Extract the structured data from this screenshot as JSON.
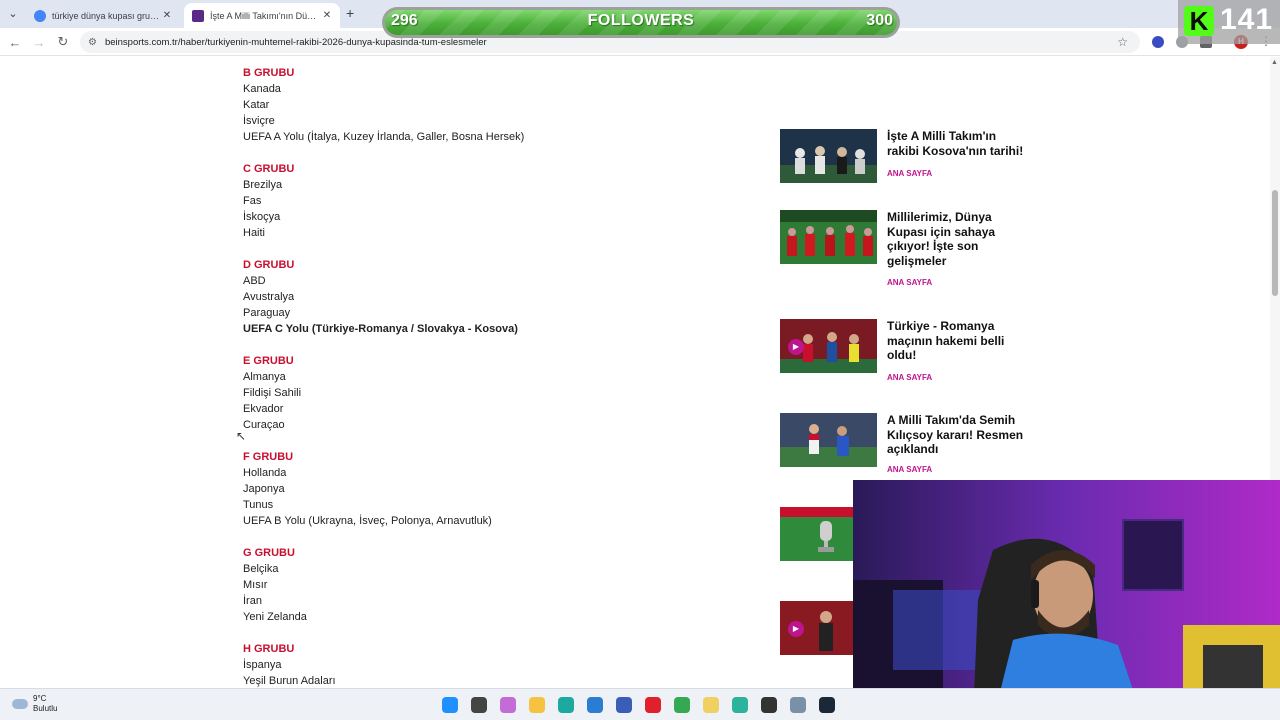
{
  "browser": {
    "tabs": [
      {
        "title": "türkiye dünya kupası gruplar - G",
        "active": false,
        "favicon_color": "#4285f4"
      },
      {
        "title": "İşte A Milli Takımı'nın Dünya Ku",
        "active": true,
        "favicon_color": "#5b2a86"
      }
    ],
    "url": "beinsports.com.tr/haber/turkiyenin-muhtemel-rakibi-2026-dunya-kupasinda-tum-eslesmeler",
    "profile_initial": "H"
  },
  "overlay": {
    "followers_current": "296",
    "followers_label": "FOLLOWERS",
    "followers_goal": "300",
    "kick_logo": "K",
    "kick_viewers": "141"
  },
  "groups": [
    {
      "name": "B GRUBU",
      "teams": [
        {
          "t": "Kanada"
        },
        {
          "t": "Katar"
        },
        {
          "t": "İsviçre"
        },
        {
          "t": "UEFA A Yolu (İtalya, Kuzey İrlanda, Galler, Bosna Hersek)"
        }
      ]
    },
    {
      "name": "C GRUBU",
      "teams": [
        {
          "t": "Brezilya"
        },
        {
          "t": "Fas"
        },
        {
          "t": "İskoçya"
        },
        {
          "t": "Haiti"
        }
      ]
    },
    {
      "name": "D GRUBU",
      "teams": [
        {
          "t": "ABD"
        },
        {
          "t": "Avustralya"
        },
        {
          "t": "Paraguay"
        },
        {
          "t": "UEFA C Yolu (Türkiye-Romanya / Slovakya - Kosova)",
          "bold": true
        }
      ]
    },
    {
      "name": "E GRUBU",
      "teams": [
        {
          "t": "Almanya"
        },
        {
          "t": "Fildişi Sahili"
        },
        {
          "t": "Ekvador"
        },
        {
          "t": "Curaçao"
        }
      ]
    },
    {
      "name": "F GRUBU",
      "teams": [
        {
          "t": "Hollanda"
        },
        {
          "t": "Japonya"
        },
        {
          "t": "Tunus"
        },
        {
          "t": "UEFA B Yolu (Ukrayna, İsveç, Polonya, Arnavutluk)"
        }
      ]
    },
    {
      "name": "G GRUBU",
      "teams": [
        {
          "t": "Belçika"
        },
        {
          "t": "Mısır"
        },
        {
          "t": "İran"
        },
        {
          "t": "Yeni Zelanda"
        }
      ]
    },
    {
      "name": "H GRUBU",
      "teams": [
        {
          "t": "İspanya"
        },
        {
          "t": "Yeşil Burun Adaları"
        }
      ]
    }
  ],
  "sidebar": [
    {
      "headline": "İşte A Milli Takım'ın rakibi Kosova'nın tarihi!",
      "category": "ANA SAYFA",
      "video": false
    },
    {
      "headline": "Millilerimiz, Dünya Kupası için sahaya çıkıyor! İşte son gelişmeler",
      "category": "ANA SAYFA",
      "video": false
    },
    {
      "headline": "Türkiye - Romanya maçının hakemi belli oldu!",
      "category": "ANA SAYFA",
      "video": true
    },
    {
      "headline": "A Milli Takım'da Semih Kılıçsoy kararı! Resmen açıklandı",
      "category": "ANA SAYFA",
      "video": false
    },
    {
      "headline": "",
      "category": "",
      "video": false
    },
    {
      "headline": "",
      "category": "",
      "video": true
    }
  ],
  "taskbar": {
    "weather_temp": "9°C",
    "weather_desc": "Bulutlu",
    "icons": [
      {
        "name": "windows-start-icon",
        "color": "#1e90ff"
      },
      {
        "name": "task-view-icon",
        "color": "#444444"
      },
      {
        "name": "copilot-icon",
        "color": "#c36bd6"
      },
      {
        "name": "file-explorer-icon",
        "color": "#f5c242"
      },
      {
        "name": "edge-icon",
        "color": "#1ba9a0"
      },
      {
        "name": "store-icon",
        "color": "#2b7cd3"
      },
      {
        "name": "app-icon",
        "color": "#3a5db8"
      },
      {
        "name": "opera-icon",
        "color": "#e0202b"
      },
      {
        "name": "chrome-icon",
        "color": "#34a853"
      },
      {
        "name": "folder-icon",
        "color": "#f0d060"
      },
      {
        "name": "terminal-icon",
        "color": "#2bb39b"
      },
      {
        "name": "obs-icon",
        "color": "#333333"
      },
      {
        "name": "settings-icon",
        "color": "#7a8fa8"
      },
      {
        "name": "steam-icon",
        "color": "#1b2838"
      }
    ]
  }
}
